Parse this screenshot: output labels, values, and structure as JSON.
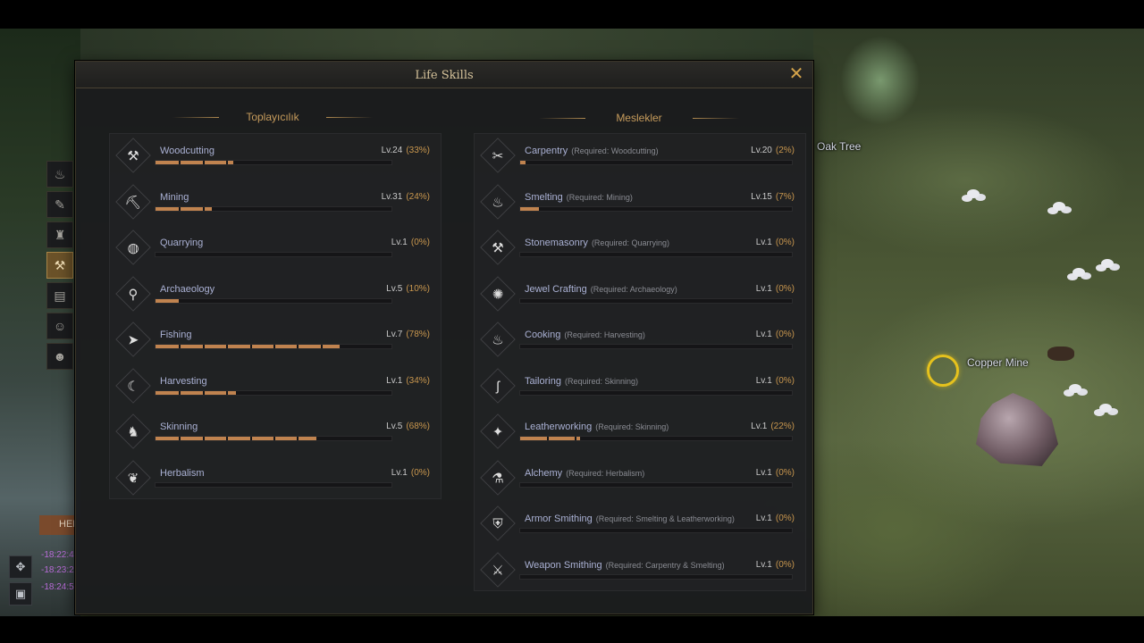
{
  "window": {
    "title": "Life Skills",
    "close_label": "✕"
  },
  "side_tabs": [
    {
      "icon": "pot-icon",
      "glyph": "♨",
      "active": false
    },
    {
      "icon": "scroll-icon",
      "glyph": "✎",
      "active": false
    },
    {
      "icon": "lamp-icon",
      "glyph": "♜",
      "active": false
    },
    {
      "icon": "life-skills-icon",
      "glyph": "⚒",
      "active": true
    },
    {
      "icon": "book-icon",
      "glyph": "▤",
      "active": false
    },
    {
      "icon": "people-icon",
      "glyph": "☺",
      "active": false
    },
    {
      "icon": "emote-icon",
      "glyph": "☻",
      "active": false
    }
  ],
  "gathering": {
    "title": "Toplayıcılık",
    "skills": [
      {
        "name": "Woodcutting",
        "level": "Lv.24",
        "percent": "(33%)",
        "progress": 0.33,
        "icon": "axe-icon",
        "glyph": "⚒"
      },
      {
        "name": "Mining",
        "level": "Lv.31",
        "percent": "(24%)",
        "progress": 0.24,
        "icon": "pickaxe-icon",
        "glyph": "⛏"
      },
      {
        "name": "Quarrying",
        "level": "Lv.1",
        "percent": "(0%)",
        "progress": 0.0,
        "icon": "stone-icon",
        "glyph": "◍"
      },
      {
        "name": "Archaeology",
        "level": "Lv.5",
        "percent": "(10%)",
        "progress": 0.1,
        "icon": "shovel-icon",
        "glyph": "⚲"
      },
      {
        "name": "Fishing",
        "level": "Lv.7",
        "percent": "(78%)",
        "progress": 0.78,
        "icon": "fish-icon",
        "glyph": "➤"
      },
      {
        "name": "Harvesting",
        "level": "Lv.1",
        "percent": "(34%)",
        "progress": 0.34,
        "icon": "sickle-icon",
        "glyph": "☾"
      },
      {
        "name": "Skinning",
        "level": "Lv.5",
        "percent": "(68%)",
        "progress": 0.68,
        "icon": "animal-icon",
        "glyph": "♞"
      },
      {
        "name": "Herbalism",
        "level": "Lv.1",
        "percent": "(0%)",
        "progress": 0.0,
        "icon": "herb-icon",
        "glyph": "❦"
      }
    ]
  },
  "professions": {
    "title": "Meslekler",
    "skills": [
      {
        "name": "Carpentry",
        "requirement": "(Required: Woodcutting)",
        "level": "Lv.20",
        "percent": "(2%)",
        "progress": 0.02,
        "icon": "saw-icon",
        "glyph": "✂"
      },
      {
        "name": "Smelting",
        "requirement": "(Required: Mining)",
        "level": "Lv.15",
        "percent": "(7%)",
        "progress": 0.07,
        "icon": "furnace-icon",
        "glyph": "♨"
      },
      {
        "name": "Stonemasonry",
        "requirement": "(Required: Quarrying)",
        "level": "Lv.1",
        "percent": "(0%)",
        "progress": 0.0,
        "icon": "hammer-icon",
        "glyph": "⚒"
      },
      {
        "name": "Jewel Crafting",
        "requirement": "(Required: Archaeology)",
        "level": "Lv.1",
        "percent": "(0%)",
        "progress": 0.0,
        "icon": "gem-icon",
        "glyph": "✺"
      },
      {
        "name": "Cooking",
        "requirement": "(Required: Harvesting)",
        "level": "Lv.1",
        "percent": "(0%)",
        "progress": 0.0,
        "icon": "cooking-pot-icon",
        "glyph": "♨"
      },
      {
        "name": "Tailoring",
        "requirement": "(Required: Skinning)",
        "level": "Lv.1",
        "percent": "(0%)",
        "progress": 0.0,
        "icon": "needle-icon",
        "glyph": "ʃ"
      },
      {
        "name": "Leatherworking",
        "requirement": "(Required: Skinning)",
        "level": "Lv.1",
        "percent": "(22%)",
        "progress": 0.22,
        "icon": "leather-icon",
        "glyph": "✦"
      },
      {
        "name": "Alchemy",
        "requirement": "(Required: Herbalism)",
        "level": "Lv.1",
        "percent": "(0%)",
        "progress": 0.0,
        "icon": "flask-icon",
        "glyph": "⚗"
      },
      {
        "name": "Armor Smithing",
        "requirement": "(Required: Smelting & Leatherworking)",
        "level": "Lv.1",
        "percent": "(0%)",
        "progress": 0.0,
        "icon": "armor-icon",
        "glyph": "⛨"
      },
      {
        "name": "Weapon Smithing",
        "requirement": "(Required: Carpentry & Smelting)",
        "level": "Lv.1",
        "percent": "(0%)",
        "progress": 0.0,
        "icon": "sword-icon",
        "glyph": "⚔"
      }
    ]
  },
  "world": {
    "oak_label": "Oak Tree",
    "copper_label": "Copper Mine"
  },
  "hud": {
    "tab_label": "HEI",
    "chat_times": [
      "-18:22:4",
      "-18:23:2",
      "-18:24:5"
    ]
  },
  "colors": {
    "accent_gold": "#c79c5c",
    "progress": "#c0834f",
    "skill_name": "#aab1d4",
    "target_ring": "#e6c21d"
  }
}
